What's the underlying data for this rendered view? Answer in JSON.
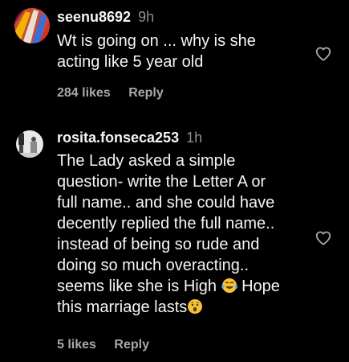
{
  "comments": [
    {
      "username": "seenu8692",
      "time": "9h",
      "lines": [
        "Wt is going on ... why is she",
        "acting like 5 year old"
      ],
      "likes": "284 likes",
      "reply": "Reply",
      "avatar_icon": "profile-avatar"
    },
    {
      "username": "rosita.fonseca253",
      "time": "1h",
      "lines": [
        "The Lady asked a simple",
        "question- write the Letter A or",
        "full name.. and she could have",
        "decently replied the full name..",
        "instead of being so rude and",
        "doing so much overacting..",
        "seems like she is High",
        "Hope",
        "this marriage lasts"
      ],
      "emojis": [
        "face-with-tears-of-joy-emoji",
        "hushed-face-emoji"
      ],
      "likes": "5 likes",
      "reply": "Reply",
      "avatar_icon": "profile-avatar"
    }
  ],
  "colors": {
    "background": "#000000",
    "text": "#f5f5f5",
    "muted": "#a8a8a8",
    "timestamp": "#8e8e8e"
  },
  "icons": [
    "heart-icon"
  ]
}
